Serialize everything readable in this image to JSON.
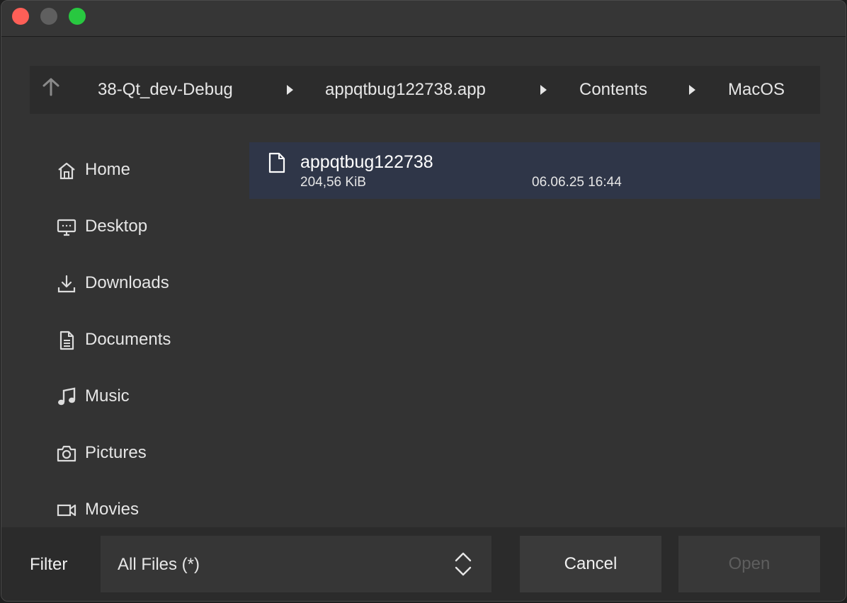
{
  "window": {
    "controls": [
      "close",
      "minimize",
      "zoom"
    ]
  },
  "pathbar": {
    "up_icon": "arrow-up-icon",
    "crumbs": [
      "38-Qt_dev-Debug",
      "appqtbug122738.app",
      "Contents",
      "MacOS"
    ]
  },
  "sidebar": {
    "items": [
      {
        "label": "Home",
        "icon": "home-icon"
      },
      {
        "label": "Desktop",
        "icon": "desktop-icon"
      },
      {
        "label": "Downloads",
        "icon": "download-icon"
      },
      {
        "label": "Documents",
        "icon": "document-icon"
      },
      {
        "label": "Music",
        "icon": "music-icon"
      },
      {
        "label": "Pictures",
        "icon": "camera-icon"
      },
      {
        "label": "Movies",
        "icon": "video-icon"
      }
    ]
  },
  "files": [
    {
      "name": "appqtbug122738",
      "size": "204,56 KiB",
      "modified": "06.06.25 16:44",
      "selected": true,
      "icon": "file-icon"
    }
  ],
  "footer": {
    "filter_label": "Filter",
    "filter_value": "All Files (*)",
    "cancel_label": "Cancel",
    "open_label": "Open"
  },
  "colors": {
    "selection": "#2f3648",
    "close": "#fe5f57",
    "zoom": "#28c840"
  }
}
